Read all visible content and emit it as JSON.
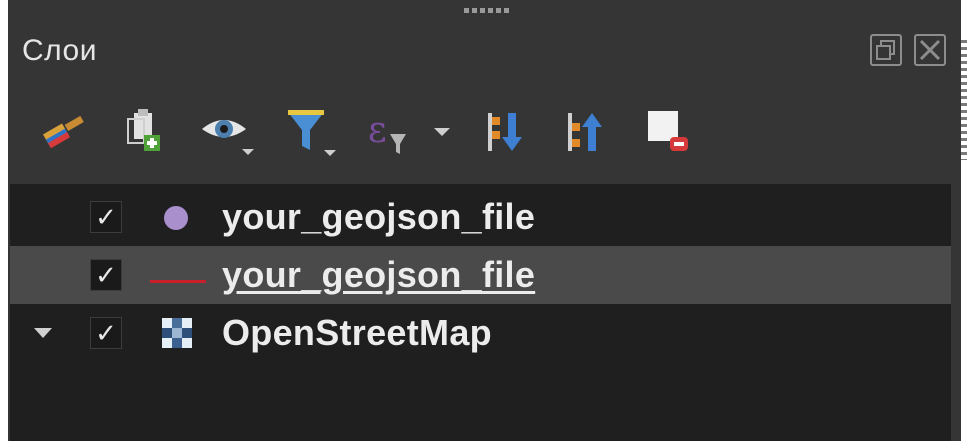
{
  "panel": {
    "title": "Слои",
    "float_icon": "restore-window-icon",
    "close_icon": "close-window-icon"
  },
  "toolbar": {
    "items": [
      {
        "name": "style-brush-icon"
      },
      {
        "name": "add-group-icon"
      },
      {
        "name": "visibility-eye-icon"
      },
      {
        "name": "filter-funnel-icon"
      },
      {
        "name": "filter-expression-icon"
      },
      {
        "name": "expand-all-icon"
      },
      {
        "name": "collapse-all-icon"
      },
      {
        "name": "remove-layer-icon"
      }
    ]
  },
  "layers": [
    {
      "label": "your_geojson_file",
      "checked": "✓",
      "symbol": "point",
      "color": "#a98fcb",
      "selected": false
    },
    {
      "label": "your_geojson_file",
      "checked": "✓",
      "symbol": "line",
      "color": "#c8202a",
      "selected": true
    },
    {
      "label": "OpenStreetMap",
      "checked": "✓",
      "symbol": "raster",
      "selected": false,
      "expandable": true
    }
  ],
  "colors": {
    "panel_bg": "#353535",
    "tree_bg": "#1f1f1f",
    "selected_bg": "#4a4a4a",
    "text": "#ececec"
  }
}
